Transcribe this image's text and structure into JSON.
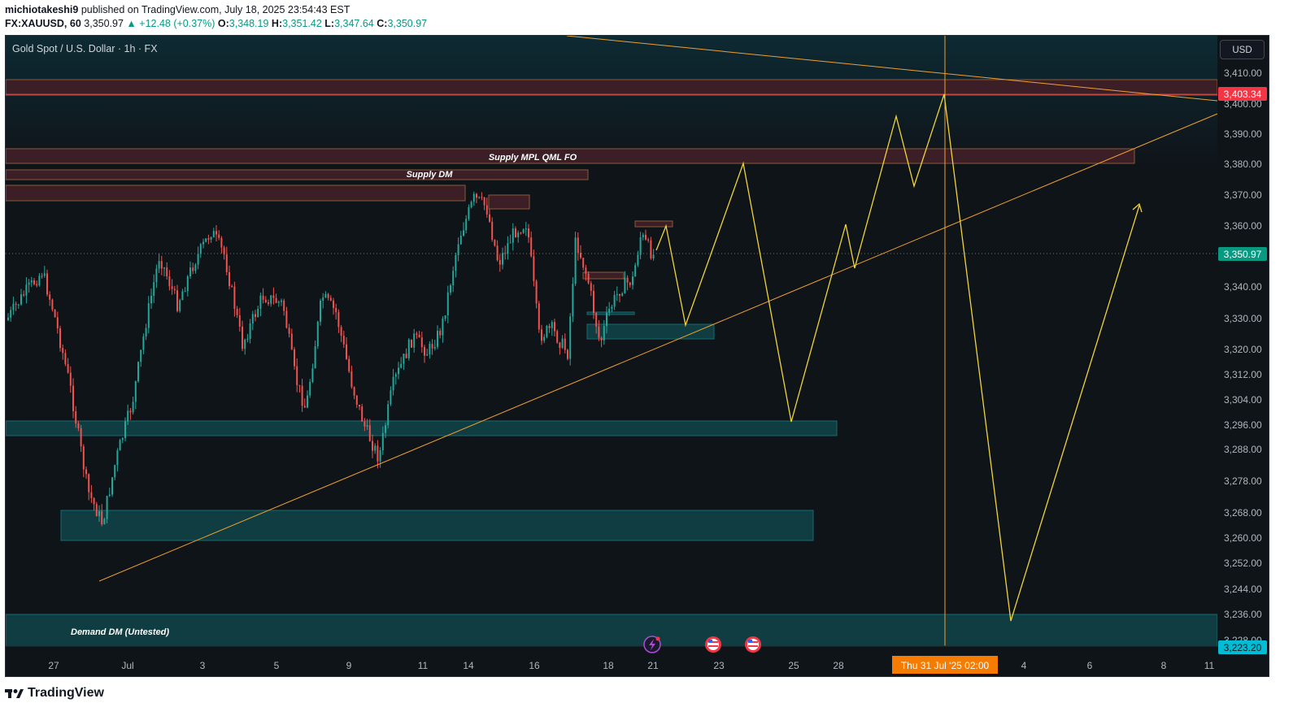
{
  "header": {
    "author": "michiotakeshi9",
    "published": "published on TradingView.com, July 18, 2025 23:54:43 EST",
    "symbol": "FX:XAUUSD, 60",
    "last": "3,350.97",
    "change": "▲ +12.48 (+0.37%)",
    "o_label": "O:",
    "o_value": "3,348.19",
    "h_label": "H:",
    "h_value": "3,351.42",
    "l_label": "L:",
    "l_value": "3,347.64",
    "c_label": "C:",
    "c_value": "3,350.97"
  },
  "chart_title": "Gold Spot / U.S. Dollar · 1h · FX",
  "currency_button": "USD",
  "price_axis": {
    "ticks": [
      "3,410.00",
      "3,400.00",
      "3,390.00",
      "3,380.00",
      "3,370.00",
      "3,360.00",
      "3,340.00",
      "3,330.00",
      "3,320.00",
      "3,312.00",
      "3,304.00",
      "3,296.00",
      "3,288.00",
      "3,278.00",
      "3,268.00",
      "3,260.00",
      "3,252.00",
      "3,244.00",
      "3,236.00",
      "3,228.00"
    ],
    "last_price_badge": "3,350.97",
    "resistance_badge": "3,403.34",
    "bottom_badge": "3,223.20"
  },
  "time_axis": {
    "ticks": [
      "27",
      "Jul",
      "3",
      "5",
      "9",
      "11",
      "14",
      "16",
      "18",
      "21",
      "23",
      "25",
      "28",
      "4",
      "6",
      "8",
      "11"
    ],
    "crosshair_label": "Thu 31 Jul '25   02:00"
  },
  "zones": {
    "supply_mpl": "Supply MPL QML FO",
    "supply_dm": "Supply DM",
    "demand_dm": "Demand DM (Untested)"
  },
  "colors": {
    "background": "#0f1419",
    "bull": "#26a69a",
    "bear": "#ef5350",
    "supply_zone": "#3c1f26",
    "demand_zone": "#0f3d42",
    "projection": "#f0d43a",
    "trendline": "#f0a030",
    "last_price": "#089981",
    "resistance": "#f23645",
    "crosshair_label": "#f57c00"
  },
  "icons": [
    "lightning-event-icon",
    "us-flag-event-icon",
    "us-flag-event-icon"
  ],
  "branding": "TradingView"
}
